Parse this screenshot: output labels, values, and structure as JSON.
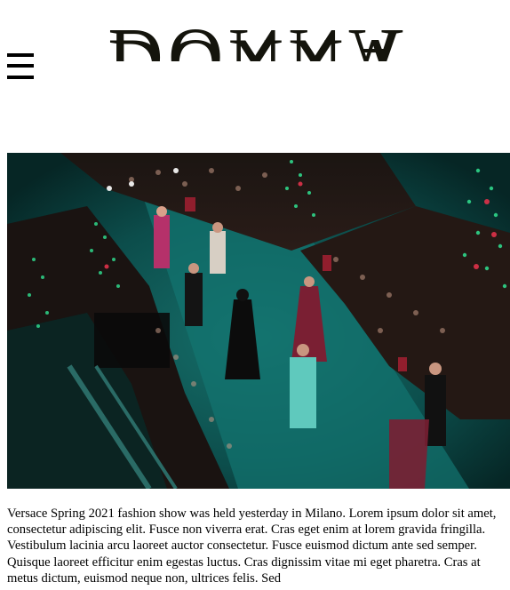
{
  "header": {
    "menu_icon": "hamburger-menu-icon",
    "logo_text": "DONNA"
  },
  "hero": {
    "description": ""
  },
  "article": {
    "body": "Versace Spring 2021 fashion show was held yesterday in Milano. Lorem ipsum dolor sit amet, consectetur adipiscing elit. Fusce non viverra erat. Cras eget enim at lorem gravida fringilla. Vestibulum lacinia arcu laoreet auctor consectetur. Fusce euismod dictum ante sed semper. Quisque laoreet efficitur enim egestas luctus. Cras dignissim vitae mi eget pharetra. Cras at metus dictum, euismod neque non, ultrices felis. Sed"
  },
  "colors": {
    "logo_ink": "#14140c",
    "runway_teal": "#0f5f5c",
    "light_green": "#2fd68a",
    "light_red": "#e0324a"
  }
}
